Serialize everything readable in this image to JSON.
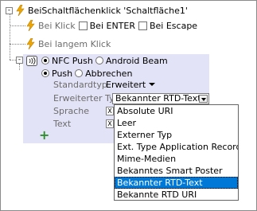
{
  "root": {
    "expander": "-",
    "label": "BeiSchaltflächenklick 'Schaltfläche1'"
  },
  "events": {
    "bei_klick": "Bei Klick",
    "bei_enter": "Bei ENTER",
    "bei_escape": "Bei Escape",
    "bei_langem_klick": "Bei langem Klick",
    "expander": "-"
  },
  "action": {
    "nfc_push": "NFC Push",
    "android_beam": "Android Beam",
    "push": "Push",
    "abbrechen": "Abbrechen",
    "fields": {
      "standardtyp_label": "Standardtyp",
      "standardtyp_value": "Erweitert",
      "erweiterter_typ_label": "Erweiterter Typ",
      "erweiterter_typ_value": "Bekannter RTD-Text",
      "sprache_label": "Sprache",
      "text_label": "Text",
      "xpath_glyph": "X"
    },
    "add_glyph": "+"
  },
  "dropdown": {
    "options": [
      "Absolute URI",
      "Leer",
      "Externer Typ",
      "Ext. Type Application Record",
      "Mime-Medien",
      "Bekanntes Smart Poster",
      "Bekannter RTD-Text",
      "Bekannte RTD URI"
    ],
    "selected": "Bekannter RTD-Text"
  },
  "colors": {
    "panel": "#e3e3f7",
    "selection": "#0078d7",
    "bolt": "#f0a800",
    "plus": "#2c8f2c"
  }
}
